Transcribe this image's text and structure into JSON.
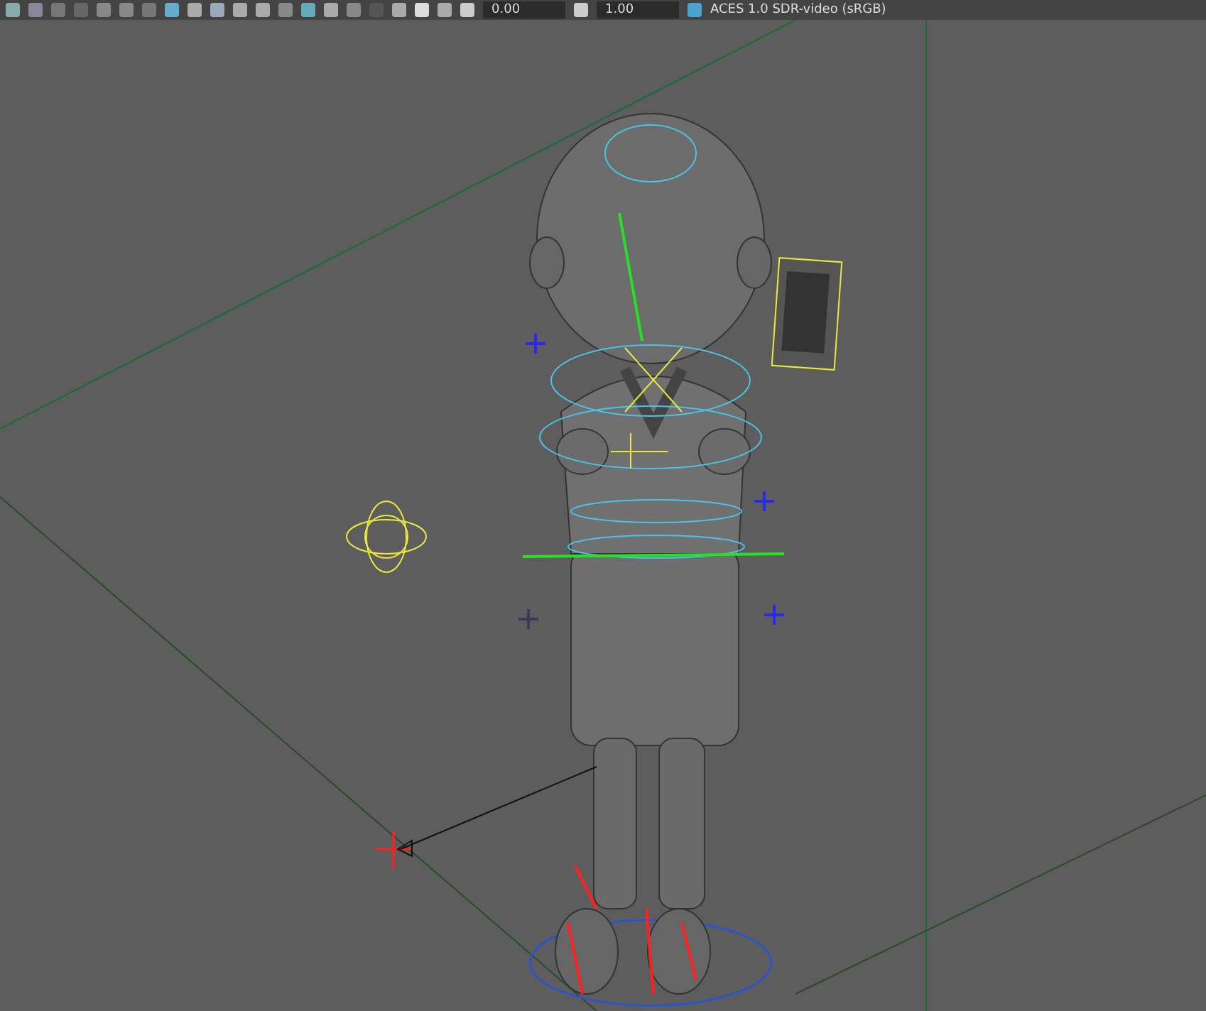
{
  "toolbar": {
    "exposure": "0.00",
    "gamma": "1.00",
    "color_space": "ACES 1.0 SDR-video (sRGB)"
  }
}
